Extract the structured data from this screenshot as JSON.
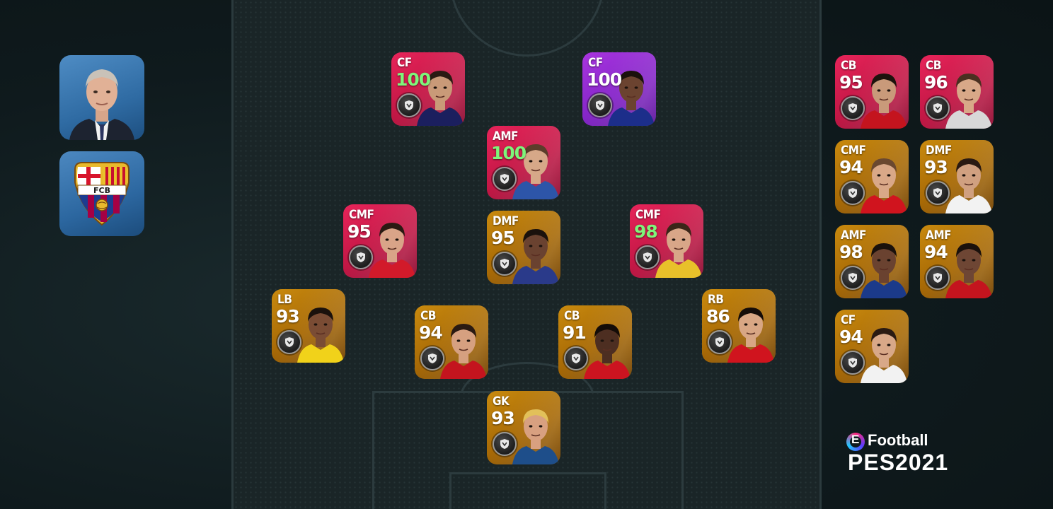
{
  "manager": {
    "icon": "manager-portrait"
  },
  "club": {
    "icon": "fc-barcelona-crest",
    "crest_text": "FCB"
  },
  "formation": [
    {
      "id": "cf-left",
      "pos": "CF",
      "ovr": "100",
      "boosted": true,
      "rarity": "red",
      "skin": "#c99a78",
      "hair": "#2a1a12",
      "kit": "#1b1f5e"
    },
    {
      "id": "cf-right",
      "pos": "CF",
      "ovr": "100",
      "boosted": false,
      "rarity": "purple",
      "skin": "#6b4330",
      "hair": "#1a110c",
      "kit": "#1c2e8a"
    },
    {
      "id": "amf",
      "pos": "AMF",
      "ovr": "100",
      "boosted": true,
      "rarity": "red",
      "skin": "#d6a888",
      "hair": "#5b3d2a",
      "kit": "#2d55a8"
    },
    {
      "id": "cmf-left",
      "pos": "CMF",
      "ovr": "95",
      "boosted": false,
      "rarity": "red",
      "skin": "#d9a488",
      "hair": "#2a1a12",
      "kit": "#d21a2a"
    },
    {
      "id": "dmf",
      "pos": "DMF",
      "ovr": "95",
      "boosted": false,
      "rarity": "gold",
      "skin": "#6a4230",
      "hair": "#1a110c",
      "kit": "#2a3a8a"
    },
    {
      "id": "cmf-right",
      "pos": "CMF",
      "ovr": "98",
      "boosted": true,
      "rarity": "red",
      "skin": "#d8a688",
      "hair": "#3b2618",
      "kit": "#e8c12a"
    },
    {
      "id": "lb",
      "pos": "LB",
      "ovr": "93",
      "boosted": false,
      "rarity": "gold",
      "skin": "#7a4c34",
      "hair": "#1a110c",
      "kit": "#f1d21a"
    },
    {
      "id": "cb-left",
      "pos": "CB",
      "ovr": "94",
      "boosted": false,
      "rarity": "gold",
      "skin": "#d6a080",
      "hair": "#2a1a12",
      "kit": "#c4141e"
    },
    {
      "id": "cb-right",
      "pos": "CB",
      "ovr": "91",
      "boosted": false,
      "rarity": "gold",
      "skin": "#4d2e21",
      "hair": "#140c08",
      "kit": "#cc1420"
    },
    {
      "id": "rb",
      "pos": "RB",
      "ovr": "86",
      "boosted": false,
      "rarity": "gold",
      "skin": "#d8a684",
      "hair": "#140c08",
      "kit": "#d0141e"
    },
    {
      "id": "gk",
      "pos": "GK",
      "ovr": "93",
      "boosted": false,
      "rarity": "gold",
      "skin": "#d8a080",
      "hair": "#e2c05a",
      "kit": "#1e4e8a"
    }
  ],
  "subs": [
    {
      "id": "sub-1",
      "pos": "CB",
      "ovr": "95",
      "boosted": false,
      "rarity": "red",
      "skin": "#c99a7a",
      "hair": "#1d130d",
      "kit": "#c4141e"
    },
    {
      "id": "sub-2",
      "pos": "CB",
      "ovr": "96",
      "boosted": false,
      "rarity": "red",
      "skin": "#d8a888",
      "hair": "#4a3020",
      "kit": "#d8d8d8"
    },
    {
      "id": "sub-3",
      "pos": "CMF",
      "ovr": "94",
      "boosted": false,
      "rarity": "gold",
      "skin": "#d9a888",
      "hair": "#6a4830",
      "kit": "#d0141e"
    },
    {
      "id": "sub-4",
      "pos": "DMF",
      "ovr": "93",
      "boosted": false,
      "rarity": "gold",
      "skin": "#d0a080",
      "hair": "#2a1a12",
      "kit": "#f2f2f2"
    },
    {
      "id": "sub-5",
      "pos": "AMF",
      "ovr": "98",
      "boosted": false,
      "rarity": "gold",
      "skin": "#6a4230",
      "hair": "#1a110c",
      "kit": "#1b3a8a"
    },
    {
      "id": "sub-6",
      "pos": "AMF",
      "ovr": "94",
      "boosted": false,
      "rarity": "gold",
      "skin": "#6e4634",
      "hair": "#1a110c",
      "kit": "#c4141e"
    },
    {
      "id": "sub-7",
      "pos": "CF",
      "ovr": "94",
      "boosted": false,
      "rarity": "gold",
      "skin": "#d8a888",
      "hair": "#2a1a12",
      "kit": "#f2f2f2"
    }
  ],
  "logo": {
    "brand": "Football",
    "brand_prefix": "E",
    "game": "PES2021"
  },
  "colors": {
    "boosted_rating": "#7ef57a",
    "pitch": "#1a2527",
    "background": "#0f1c1f"
  }
}
